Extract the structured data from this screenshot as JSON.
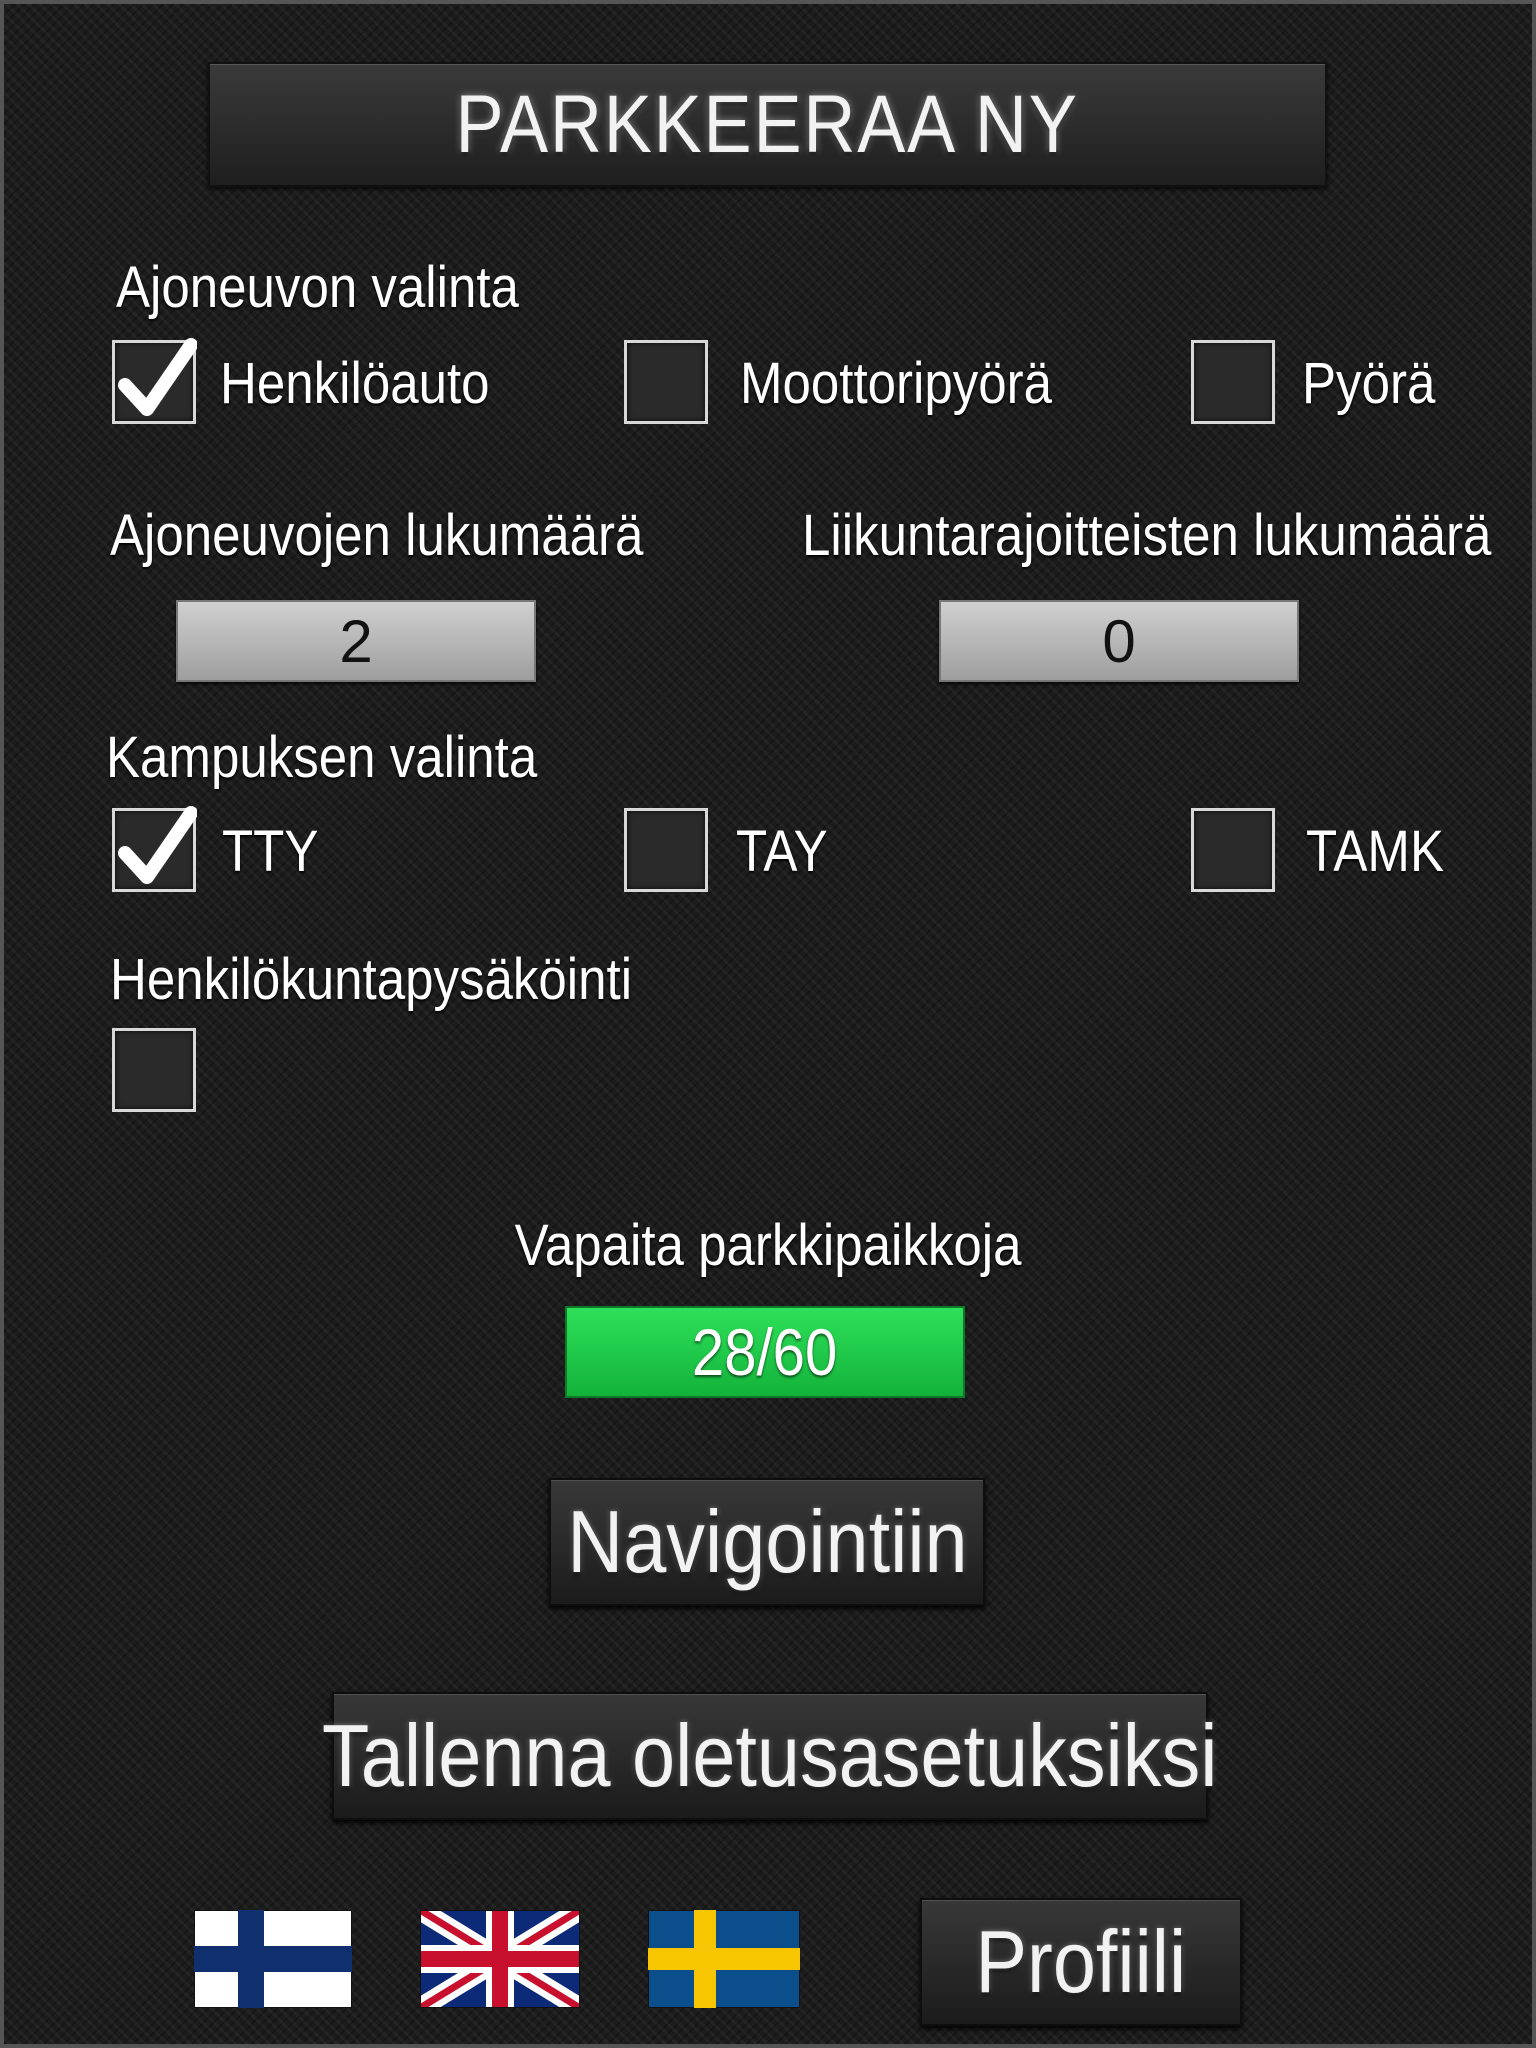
{
  "header": {
    "title": "PARKKEERAA NY"
  },
  "vehicle": {
    "heading": "Ajoneuvon valinta",
    "options": [
      {
        "label": "Henkilöauto",
        "checked": true
      },
      {
        "label": "Moottoripyörä",
        "checked": false
      },
      {
        "label": "Pyörä",
        "checked": false
      }
    ]
  },
  "counts": {
    "vehicles_label": "Ajoneuvojen lukumäärä",
    "vehicles_value": "2",
    "disabled_label": "Liikuntarajoitteisten lukumäärä",
    "disabled_value": "0"
  },
  "campus": {
    "heading": "Kampuksen valinta",
    "options": [
      {
        "label": "TTY",
        "checked": true
      },
      {
        "label": "TAY",
        "checked": false
      },
      {
        "label": "TAMK",
        "checked": false
      }
    ]
  },
  "staff": {
    "heading": "Henkilökuntapysäköinti",
    "checked": false
  },
  "availability": {
    "label": "Vapaita parkkipaikkoja",
    "value": "28/60",
    "color": "#1ccf49"
  },
  "buttons": {
    "navigate": "Navigointiin",
    "save_defaults": "Tallenna oletusasetuksiksi",
    "profile": "Profiili"
  },
  "languages": [
    "finnish-flag-icon",
    "uk-flag-icon",
    "swedish-flag-icon"
  ]
}
